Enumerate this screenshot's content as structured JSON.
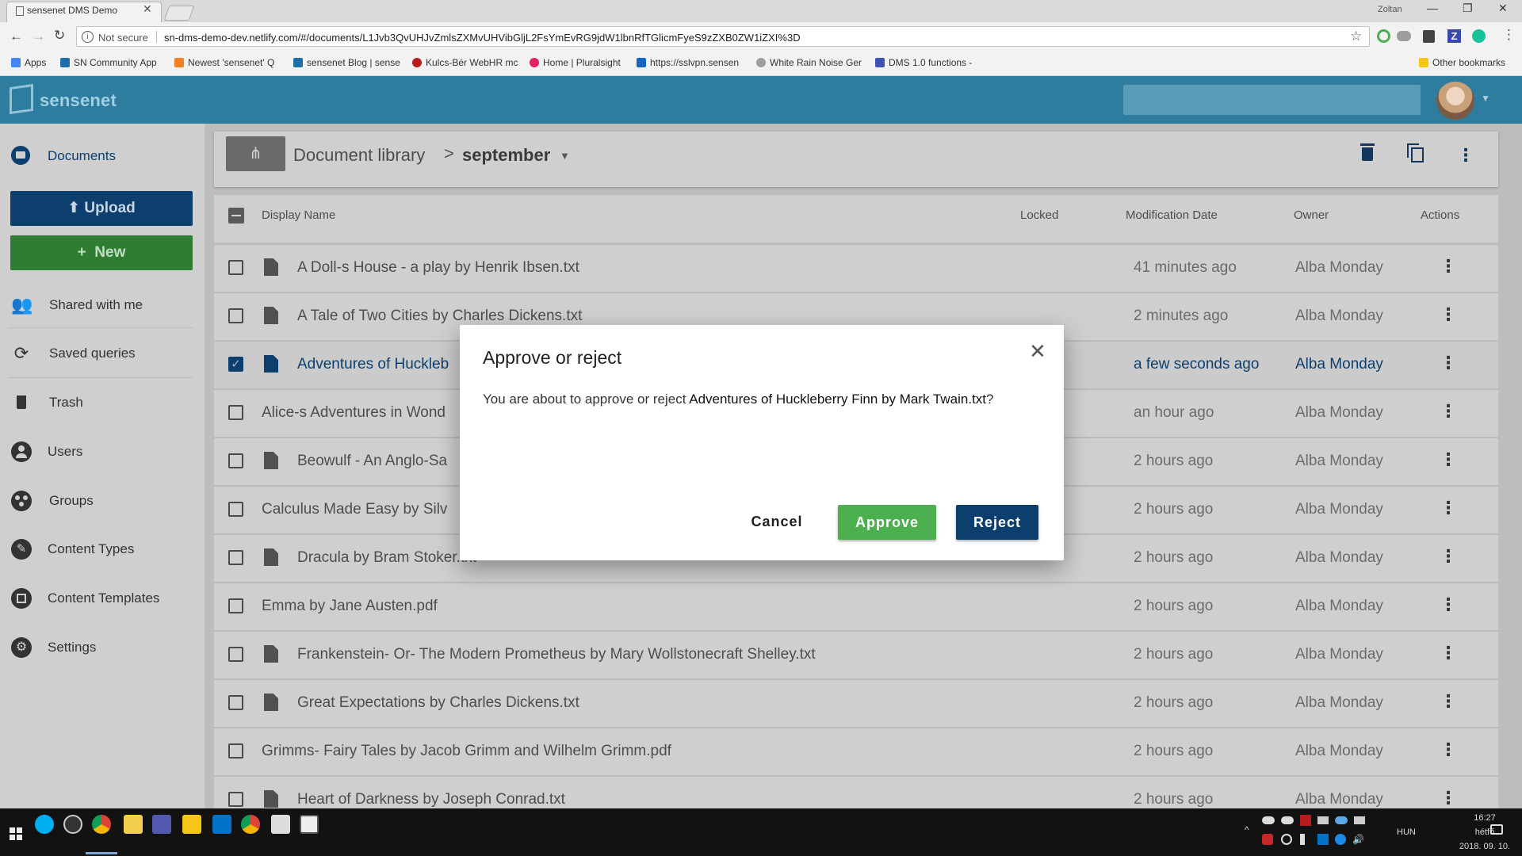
{
  "browser": {
    "tab_title": "sensenet DMS Demo",
    "tab_close": "✕",
    "window_user": "Zoltan",
    "window_controls": [
      "—",
      "❐",
      "✕"
    ],
    "nav": {
      "back": "←",
      "forward": "→",
      "reload": "↻"
    },
    "security_label": "Not secure",
    "url": "sn-dms-demo-dev.netlify.com/#/documents/L1Jvb3QvUHJvZmlsZXMvUHVibGljL2FsYmEvRG9jdW1lbnRfTGlicmFyeS9zZXB0ZW1iZXI%3D",
    "bookmarks": [
      {
        "label": "Apps",
        "color": "#4285f4"
      },
      {
        "label": "SN Community App",
        "color": "#1e6fa8"
      },
      {
        "label": "Newest 'sensenet' Q",
        "color": "#f48024"
      },
      {
        "label": "sensenet Blog | sense",
        "color": "#1e6fa8"
      },
      {
        "label": "Kulcs-Bér WebHR mc",
        "color": "#b71c1c"
      },
      {
        "label": "Home | Pluralsight",
        "color": "#e91e63"
      },
      {
        "label": "https://sslvpn.sensen",
        "color": "#1565c0"
      },
      {
        "label": "White Rain Noise Ger",
        "color": "#9e9e9e"
      },
      {
        "label": "DMS 1.0 functions - ",
        "color": "#3f51b5"
      }
    ],
    "other_bookmarks": "Other bookmarks"
  },
  "app": {
    "logo_text": "sensenet",
    "accent": "#2e7d9e",
    "primary": "#0d3f6e",
    "success": "#4caf50"
  },
  "sidebar": {
    "items": [
      {
        "label": "Documents",
        "icon": "folder-icon"
      },
      {
        "label": "Shared with me",
        "icon": "people-icon"
      },
      {
        "label": "Saved queries",
        "icon": "queries-icon"
      },
      {
        "label": "Trash",
        "icon": "trash-icon"
      },
      {
        "label": "Users",
        "icon": "user-icon"
      },
      {
        "label": "Groups",
        "icon": "groups-icon"
      },
      {
        "label": "Content Types",
        "icon": "pencil-icon"
      },
      {
        "label": "Content Templates",
        "icon": "templates-icon"
      },
      {
        "label": "Settings",
        "icon": "gear-icon"
      }
    ],
    "upload_label": "Upload",
    "new_label": "New"
  },
  "breadcrumb": {
    "library": "Document library",
    "separator": ">",
    "current": "september"
  },
  "table": {
    "columns": [
      "Display Name",
      "Locked",
      "Modification Date",
      "Owner",
      "Actions"
    ],
    "rows": [
      {
        "name": "A Doll-s House - a play by Henrik Ibsen.txt",
        "modified": "41 minutes ago",
        "owner": "Alba Monday",
        "icon": true,
        "selected": false
      },
      {
        "name": "A Tale of Two Cities by Charles Dickens.txt",
        "modified": "2 minutes ago",
        "owner": "Alba Monday",
        "icon": true,
        "selected": false
      },
      {
        "name": "Adventures of Huckleb",
        "modified": "a few seconds ago",
        "owner": "Alba Monday",
        "icon": true,
        "selected": true
      },
      {
        "name": "Alice-s Adventures in Wond",
        "modified": "an hour ago",
        "owner": "Alba Monday",
        "icon": false,
        "selected": false
      },
      {
        "name": "Beowulf - An Anglo-Sa",
        "modified": "2 hours ago",
        "owner": "Alba Monday",
        "icon": true,
        "selected": false
      },
      {
        "name": "Calculus Made Easy by Silv",
        "modified": "2 hours ago",
        "owner": "Alba Monday",
        "icon": false,
        "selected": false
      },
      {
        "name": "Dracula by Bram Stoker.txt",
        "modified": "2 hours ago",
        "owner": "Alba Monday",
        "icon": true,
        "selected": false
      },
      {
        "name": "Emma by Jane Austen.pdf",
        "modified": "2 hours ago",
        "owner": "Alba Monday",
        "icon": false,
        "selected": false
      },
      {
        "name": "Frankenstein- Or- The Modern Prometheus by Mary Wollstonecraft Shelley.txt",
        "modified": "2 hours ago",
        "owner": "Alba Monday",
        "icon": true,
        "selected": false
      },
      {
        "name": "Great Expectations by Charles Dickens.txt",
        "modified": "2 hours ago",
        "owner": "Alba Monday",
        "icon": true,
        "selected": false
      },
      {
        "name": "Grimms- Fairy Tales by Jacob Grimm and Wilhelm Grimm.pdf",
        "modified": "2 hours ago",
        "owner": "Alba Monday",
        "icon": false,
        "selected": false
      },
      {
        "name": "Heart of Darkness by Joseph Conrad.txt",
        "modified": "2 hours ago",
        "owner": "Alba Monday",
        "icon": true,
        "selected": false
      }
    ]
  },
  "dialog": {
    "title": "Approve or reject",
    "close": "✕",
    "body_prefix": "You are about to approve or reject ",
    "body_item": "Adventures of Huckleberry Finn by Mark Twain.txt",
    "body_suffix": "?",
    "cancel_label": "Cancel",
    "approve_label": "Approve",
    "reject_label": "Reject"
  },
  "taskbar": {
    "language": "HUN",
    "time": "16:27",
    "day": "hétfő",
    "date": "2018. 09. 10."
  }
}
